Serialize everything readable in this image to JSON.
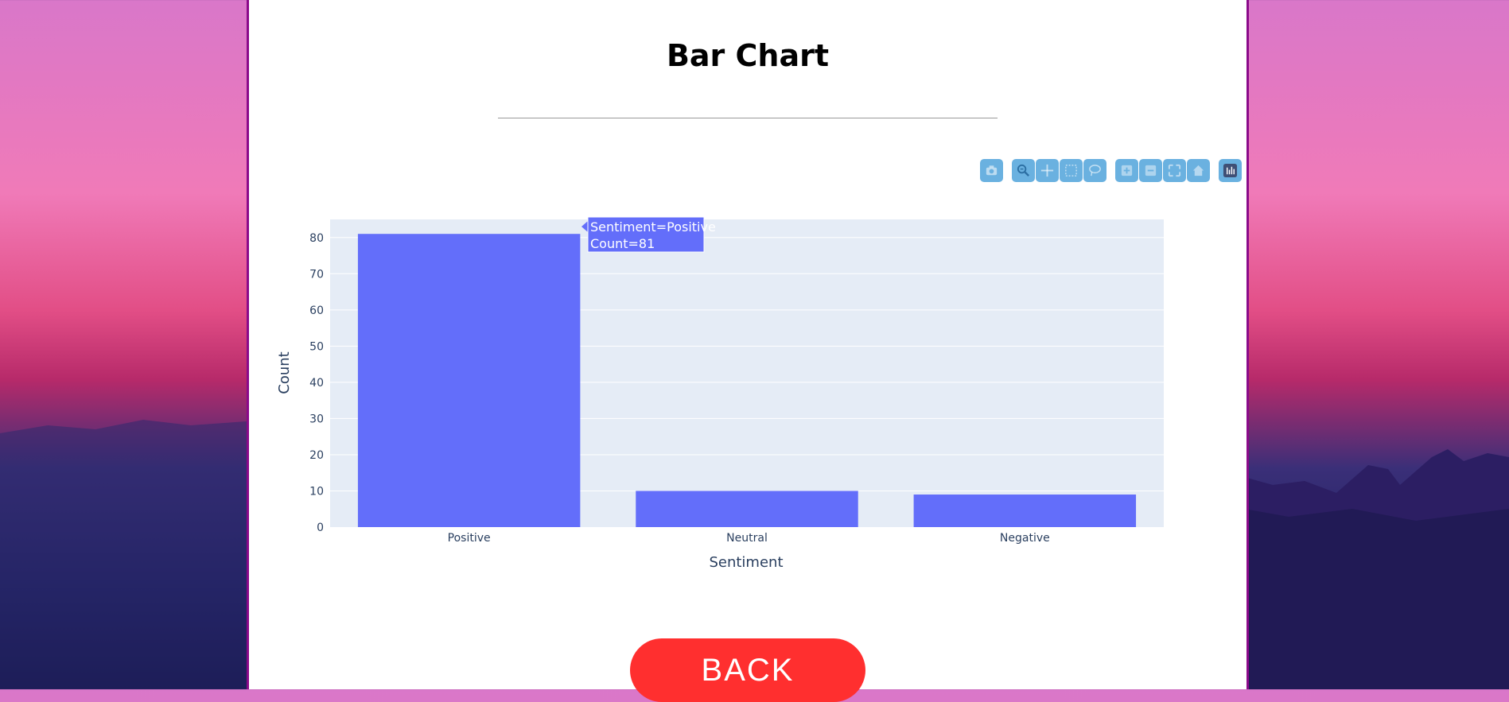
{
  "page": {
    "title": "Bar Chart",
    "back_label": "BACK"
  },
  "modebar": {
    "icons": [
      "camera-icon",
      "zoom-icon",
      "pan-icon",
      "box-select-icon",
      "lasso-select-icon",
      "zoom-in-icon",
      "zoom-out-icon",
      "autoscale-icon",
      "reset-axes-icon",
      "plotly-logo-icon"
    ]
  },
  "colors": {
    "bar": "#636efa",
    "plot_bg": "#e5ecf6",
    "back_button": "#ff2f2f",
    "frame": "#8b0a8a"
  },
  "chart_data": {
    "type": "bar",
    "categories": [
      "Positive",
      "Neutral",
      "Negative"
    ],
    "values": [
      81,
      10,
      9
    ],
    "xlabel": "Sentiment",
    "ylabel": "Count",
    "ylim": [
      0,
      85
    ],
    "yticks": [
      0,
      10,
      20,
      30,
      40,
      50,
      60,
      70,
      80
    ],
    "grid": true,
    "hover": {
      "line1": "Sentiment=Positive",
      "line2": "Count=81"
    }
  }
}
